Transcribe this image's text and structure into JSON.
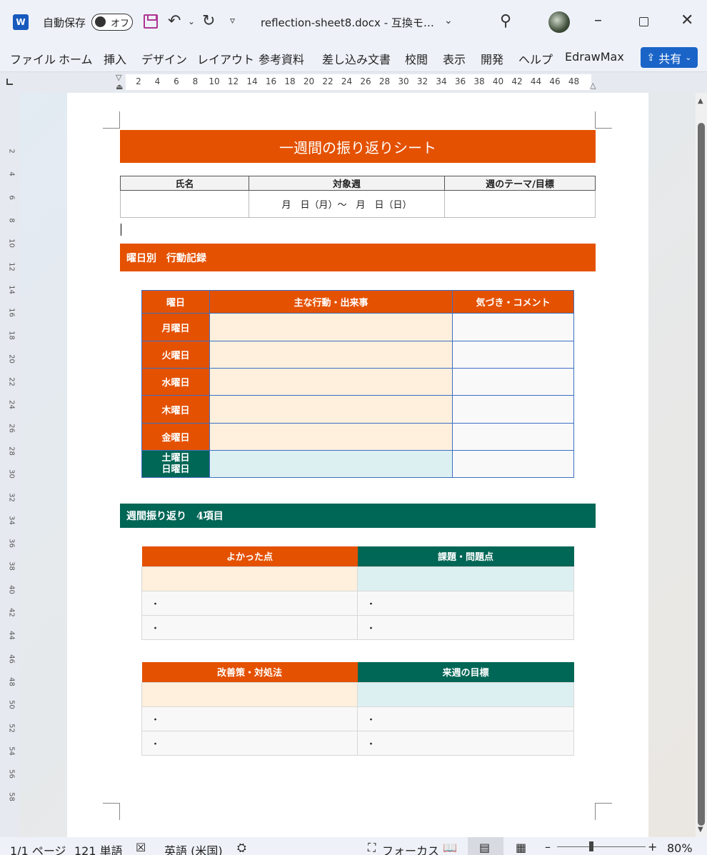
{
  "titlebar": {
    "autosave_label": "自動保存",
    "autosave_state": "オフ",
    "filename": "reflection-sheet8.docx  -  互換モ…",
    "logo": "W"
  },
  "ribbon": {
    "tabs": [
      "ファイル",
      "ホーム",
      "挿入",
      "デザイン",
      "レイアウト",
      "参考資料",
      "差し込み文書",
      "校閲",
      "表示",
      "開発",
      "ヘルプ",
      "EdrawMax"
    ],
    "share_label": "共有"
  },
  "ruler": {
    "marks": [
      "2",
      "4",
      "6",
      "8",
      "10",
      "12",
      "14",
      "16",
      "18",
      "20",
      "22",
      "24",
      "26",
      "28",
      "30",
      "32",
      "34",
      "36",
      "38",
      "40",
      "42",
      "44",
      "46",
      "48"
    ],
    "vmarks": [
      "2",
      "4",
      "6",
      "8",
      "10",
      "12",
      "14",
      "16",
      "18",
      "20",
      "22",
      "24",
      "26",
      "28",
      "30",
      "32",
      "34",
      "36",
      "38",
      "40",
      "42",
      "44",
      "46",
      "48",
      "50",
      "52",
      "54",
      "56",
      "58"
    ]
  },
  "doc": {
    "title": "一週間の振り返りシート",
    "info_headers": [
      "氏名",
      "対象週",
      "週のテーマ/目標"
    ],
    "info_values": [
      "",
      "月　日（月）～　月　日（日）",
      ""
    ],
    "section1": "曜日別　行動記録",
    "day_headers": [
      "曜日",
      "主な行動・出来事",
      "気づき・コメント"
    ],
    "days": [
      "月曜日",
      "火曜日",
      "水曜日",
      "木曜日",
      "金曜日"
    ],
    "weekend": [
      "土曜日",
      "日曜日"
    ],
    "section2": "週間振り返り　4項目",
    "review1": {
      "left": "よかった点",
      "right": "課題・問題点"
    },
    "review2": {
      "left": "改善策・対処法",
      "right": "来週の目標"
    },
    "bullet": "・",
    "colors": {
      "orange": "#e45100",
      "green": "#006656",
      "cream": "#fef0dd",
      "mint": "#ddf0f1"
    }
  },
  "status": {
    "page": "1/1 ページ",
    "words": "121 単語",
    "language": "英語 (米国)",
    "focus": "フォーカス",
    "zoom": "80%"
  }
}
